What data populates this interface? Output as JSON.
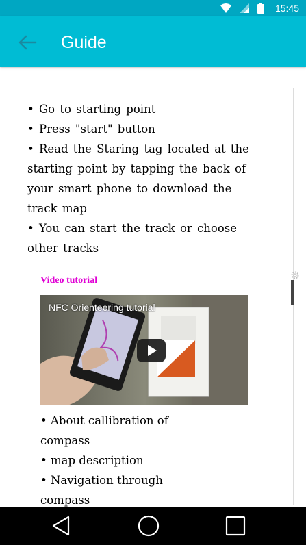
{
  "status_bar": {
    "time": "15:45",
    "icons": [
      "wifi-icon",
      "signal-icon",
      "battery-icon"
    ]
  },
  "app_bar": {
    "title": "Guide",
    "back_icon": "arrow-back-icon"
  },
  "colors": {
    "status_bar": "#00a7c2",
    "app_bar": "#00bcd4",
    "video_label": "#e000d4",
    "nav_bar": "#000000"
  },
  "content": {
    "steps": [
      "•  Go to starting point",
      "•   Press \"start\" button",
      "•  Read the Staring tag located at the starting point by tapping the back of your smart phone to download the track map",
      "• You can start the track or choose  other tracks"
    ],
    "video": {
      "label": "Video tutorial",
      "title": "NFC Orienteering tutorial",
      "play_icon": "play-icon"
    },
    "topics": [
      "• About callibration of compass",
      "• map description",
      "• Navigation through compass"
    ]
  },
  "nav_bar": {
    "icons": [
      "back-triangle-icon",
      "home-circle-icon",
      "recents-square-icon"
    ]
  }
}
